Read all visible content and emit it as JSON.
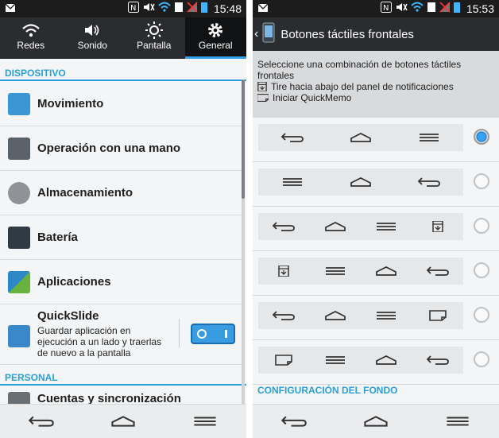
{
  "left": {
    "status": {
      "time": "15:48"
    },
    "quick_tabs": [
      {
        "label": "Redes",
        "icon": "wifi-icon"
      },
      {
        "label": "Sonido",
        "icon": "volume-icon"
      },
      {
        "label": "Pantalla",
        "icon": "brightness-icon"
      },
      {
        "label": "General",
        "icon": "gear-icon",
        "active": true
      }
    ],
    "section_dispositivo": "DISPOSITIVO",
    "items": [
      {
        "label": "Movimiento",
        "icon": "motion-icon"
      },
      {
        "label": "Operación con una mano",
        "icon": "one-hand-icon"
      },
      {
        "label": "Almacenamiento",
        "icon": "storage-icon"
      },
      {
        "label": "Batería",
        "icon": "battery-icon"
      },
      {
        "label": "Aplicaciones",
        "icon": "apps-icon"
      }
    ],
    "quickslide": {
      "title": "QuickSlide",
      "desc_line1": "Guardar aplicación en",
      "desc_line2": "ejecución a un lado y traerlas",
      "desc_line3": "de nuevo a la pantalla",
      "enabled": true
    },
    "section_personal": "PERSONAL",
    "partial_item": "Cuentas y sincronización"
  },
  "right": {
    "status": {
      "time": "15:53"
    },
    "title": "Botones táctiles frontales",
    "info_line1": "Seleccione una combinación de botones táctiles",
    "info_line2": "frontales",
    "info_line3": "Tire hacia abajo del panel de notificaciones",
    "info_line4": "Iniciar QuickMemo",
    "options": [
      {
        "buttons": [
          "back",
          "home",
          "menu"
        ],
        "selected": true
      },
      {
        "buttons": [
          "menu",
          "home",
          "back"
        ],
        "selected": false
      },
      {
        "buttons": [
          "back",
          "home",
          "menu",
          "notif"
        ],
        "selected": false
      },
      {
        "buttons": [
          "notif",
          "menu",
          "home",
          "back"
        ],
        "selected": false
      },
      {
        "buttons": [
          "back",
          "home",
          "menu",
          "memo"
        ],
        "selected": false
      },
      {
        "buttons": [
          "memo",
          "menu",
          "home",
          "back"
        ],
        "selected": false
      }
    ],
    "section_fondo": "CONFIGURACIÓN DEL FONDO"
  },
  "colors": {
    "accent": "#2aa0d8",
    "dark_bar": "#2a2c2f"
  }
}
